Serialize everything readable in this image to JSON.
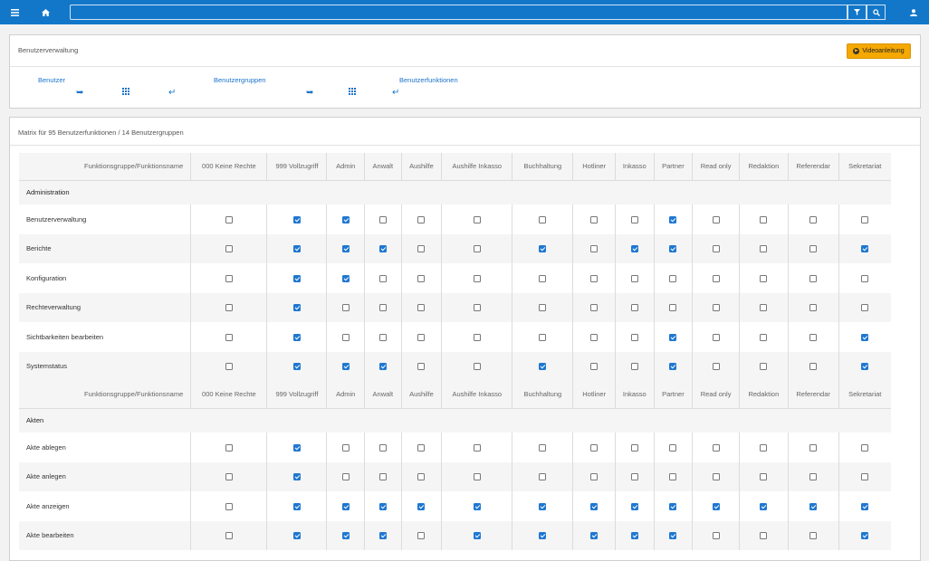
{
  "topbar": {
    "menu_icon": "hamburger-icon",
    "home_icon": "home-icon",
    "search_value": "",
    "filter_icon": "filter-icon",
    "search_icon": "search-icon",
    "user_icon": "user-icon"
  },
  "panel1": {
    "title": "Benutzerverwaltung",
    "video_button": "Videoanleitung",
    "links": [
      {
        "label": "Benutzer"
      },
      {
        "label": "Benutzergruppen"
      },
      {
        "label": "Benutzerfunktionen"
      }
    ]
  },
  "panel2": {
    "title": "Matrix für 95 Benutzerfunktionen / 14 Benutzergruppen"
  },
  "matrix": {
    "first_header": "Funktionsgruppe/Funktionsname",
    "columns": [
      "000 Keine Rechte",
      "999 Vollzugriff",
      "Admin",
      "Anwalt",
      "Aushilfe",
      "Aushilfe Inkasso",
      "Buchhaltung",
      "Hotliner",
      "Inkasso",
      "Partner",
      "Read only",
      "Redaktion",
      "Referendar",
      "Sekretariat"
    ],
    "groups": [
      {
        "name": "Administration",
        "rows": [
          {
            "label": "Benutzerverwaltung",
            "checks": [
              0,
              1,
              1,
              0,
              0,
              0,
              0,
              0,
              0,
              1,
              0,
              0,
              0,
              0
            ]
          },
          {
            "label": "Berichte",
            "checks": [
              0,
              1,
              1,
              1,
              0,
              0,
              1,
              0,
              1,
              1,
              0,
              0,
              0,
              1
            ]
          },
          {
            "label": "Konfiguration",
            "checks": [
              0,
              1,
              1,
              0,
              0,
              0,
              0,
              0,
              0,
              0,
              0,
              0,
              0,
              0
            ]
          },
          {
            "label": "Rechteverwaltung",
            "checks": [
              0,
              1,
              0,
              0,
              0,
              0,
              0,
              0,
              0,
              0,
              0,
              0,
              0,
              0
            ]
          },
          {
            "label": "Sichtbarkeiten bearbeiten",
            "checks": [
              0,
              1,
              0,
              0,
              0,
              0,
              0,
              0,
              0,
              1,
              0,
              0,
              0,
              1
            ]
          },
          {
            "label": "Systemstatus",
            "checks": [
              0,
              1,
              1,
              1,
              0,
              0,
              1,
              0,
              0,
              1,
              0,
              0,
              0,
              1
            ]
          }
        ]
      },
      {
        "name": "Akten",
        "rows": [
          {
            "label": "Akte ablegen",
            "checks": [
              0,
              1,
              0,
              0,
              0,
              0,
              0,
              0,
              0,
              0,
              0,
              0,
              0,
              0
            ]
          },
          {
            "label": "Akte anlegen",
            "checks": [
              0,
              1,
              0,
              0,
              0,
              0,
              0,
              0,
              0,
              0,
              0,
              0,
              0,
              0
            ]
          },
          {
            "label": "Akte anzeigen",
            "checks": [
              0,
              1,
              1,
              1,
              1,
              1,
              1,
              1,
              1,
              1,
              1,
              1,
              1,
              1
            ]
          },
          {
            "label": "Akte bearbeiten",
            "checks": [
              0,
              1,
              1,
              1,
              0,
              1,
              1,
              1,
              1,
              1,
              0,
              0,
              0,
              1
            ]
          }
        ]
      }
    ]
  },
  "colors": {
    "topbar": "#1277c9",
    "accent_button": "#f5a800",
    "checkbox_checked": "#1f78d1"
  }
}
